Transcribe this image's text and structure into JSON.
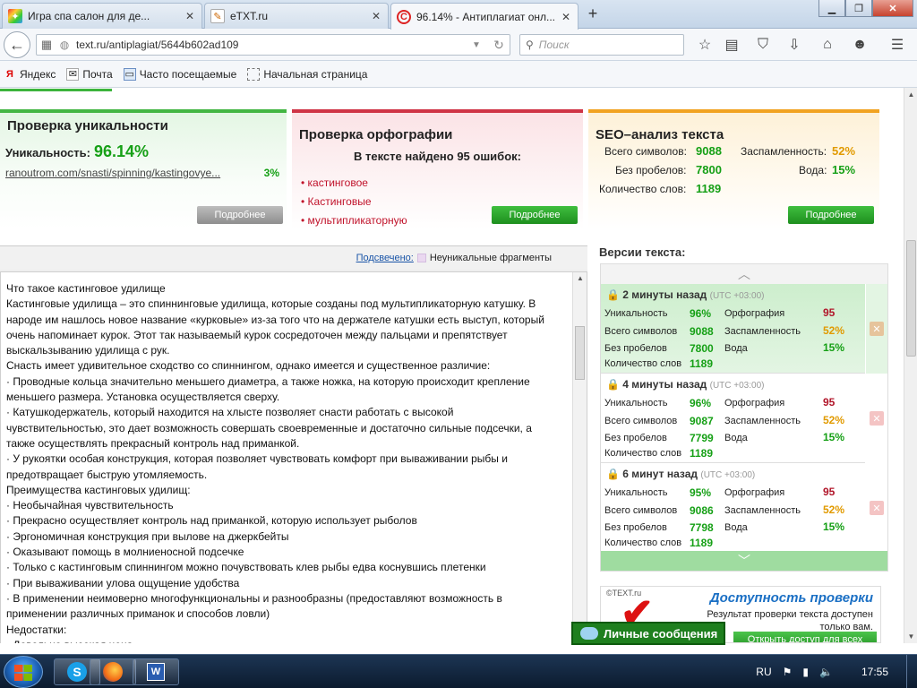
{
  "browser": {
    "tabs": [
      {
        "title": "Игра спа салон для де...",
        "icon": "game-favicon"
      },
      {
        "title": "eTXT.ru",
        "icon": "etxt-favicon"
      },
      {
        "title": "96.14% - Антиплагиат онл...",
        "icon": "copyright-favicon"
      }
    ],
    "url": "text.ru/antiplagiat/5644b602ad109",
    "search_placeholder": "Поиск",
    "bookmarks": [
      "Яндекс",
      "Почта",
      "Часто посещаемые",
      "Начальная страница"
    ]
  },
  "uniqueness": {
    "title": "Проверка уникальности",
    "label": "Уникальность:",
    "value": "96.14%",
    "source_url": "ranoutrom.com/snasti/spinning/kastingovye...",
    "source_percent": "3%",
    "more": "Подробнее"
  },
  "spelling": {
    "title": "Проверка орфографии",
    "summary": "В тексте найдено 95 ошибок:",
    "errors": [
      "кастинговое",
      "Кастинговые",
      "мультипликаторную"
    ],
    "more": "Подробнее"
  },
  "seo": {
    "title": "SEO–анализ текста",
    "chars_label": "Всего символов:",
    "chars": "9088",
    "nospace_label": "Без пробелов:",
    "nospace": "7800",
    "words_label": "Количество слов:",
    "words": "1189",
    "spam_label": "Заспамленность:",
    "spam": "52%",
    "water_label": "Вода:",
    "water": "15%",
    "more": "Подробнее"
  },
  "highlight": {
    "link": "Подсвечено:",
    "legend": "Неуникальные фрагменты"
  },
  "text_lines": [
    "Что такое кастинговое удилище",
    "Кастинговые удилища – это спиннинговые удилища, которые созданы под мультипликаторную катушку. В",
    "народе им нашлось новое название «курковые» из-за того что на держателе катушки есть выступ, который",
    "очень напоминает курок. Этот так называемый курок сосредоточен между пальцами и препятствует",
    "выскальзыванию удилища с рук.",
    "Снасть имеет удивительное сходство со спиннингом, однако имеется и существенное различие:",
    "· Проводные кольца значительно меньшего диаметра, а также ножка, на которую происходит крепление",
    "меньшего размера. Установка осуществляется сверху.",
    "·        Катушкодержатель, который находится на хлысте позволяет снасти работать с высокой",
    "чувствительностью, это дает возможность совершать своевременные и достаточно сильные подсечки, а",
    "также осуществлять прекрасный контроль над приманкой.",
    "· У рукоятки особая конструкция, которая позволяет чувствовать комфорт при вываживании рыбы и",
    "предотвращает быструю утомляемость.",
    "Преимущества кастинговых удилищ:",
    "· Необычайная чувствительность",
    "· Прекрасно осуществляет контроль над приманкой, которую использует рыболов",
    "·        Эргономичная конструкция при вылове на джеркбейты",
    "·        Оказывают помощь в молниеносной подсечке",
    "·        Только с кастинговым спиннингом можно почувствовать клев рыбы едва коснувшись плетенки",
    "·        При вываживании улова ощущение удобства",
    "·        В применении неимоверно многофункциональны и разнообразны (предоставляют возможность в",
    "применении различных приманок и способов ловли)",
    "Недостатки:",
    "· Довольно высокая цена"
  ],
  "versions": {
    "title": "Версии текста:",
    "labels": {
      "uniq": "Уникальность",
      "chars": "Всего символов",
      "nospace": "Без пробелов",
      "words": "Количество слов",
      "spell": "Орфография",
      "spam": "Заспамленность",
      "water": "Вода"
    },
    "items": [
      {
        "time": "2 минуты назад",
        "tz": "(UTC +03:00)",
        "uniq": "96%",
        "chars": "9088",
        "nospace": "7800",
        "words": "1189",
        "spell": "95",
        "spam": "52%",
        "water": "15%"
      },
      {
        "time": "4 минуты назад",
        "tz": "(UTC +03:00)",
        "uniq": "96%",
        "chars": "9087",
        "nospace": "7799",
        "words": "1189",
        "spell": "95",
        "spam": "52%",
        "water": "15%"
      },
      {
        "time": "6 минут назад",
        "tz": "(UTC +03:00)",
        "uniq": "95%",
        "chars": "9086",
        "nospace": "7798",
        "words": "1189",
        "spell": "95",
        "spam": "52%",
        "water": "15%"
      }
    ]
  },
  "access": {
    "logo": "©TEXT.ru",
    "title": "Доступность проверки",
    "desc": "Результат проверки текста доступен только вам.",
    "button": "Открыть доступ для всех"
  },
  "messages": "Личные сообщения",
  "taskbar": {
    "lang": "RU",
    "time": "17:55"
  }
}
